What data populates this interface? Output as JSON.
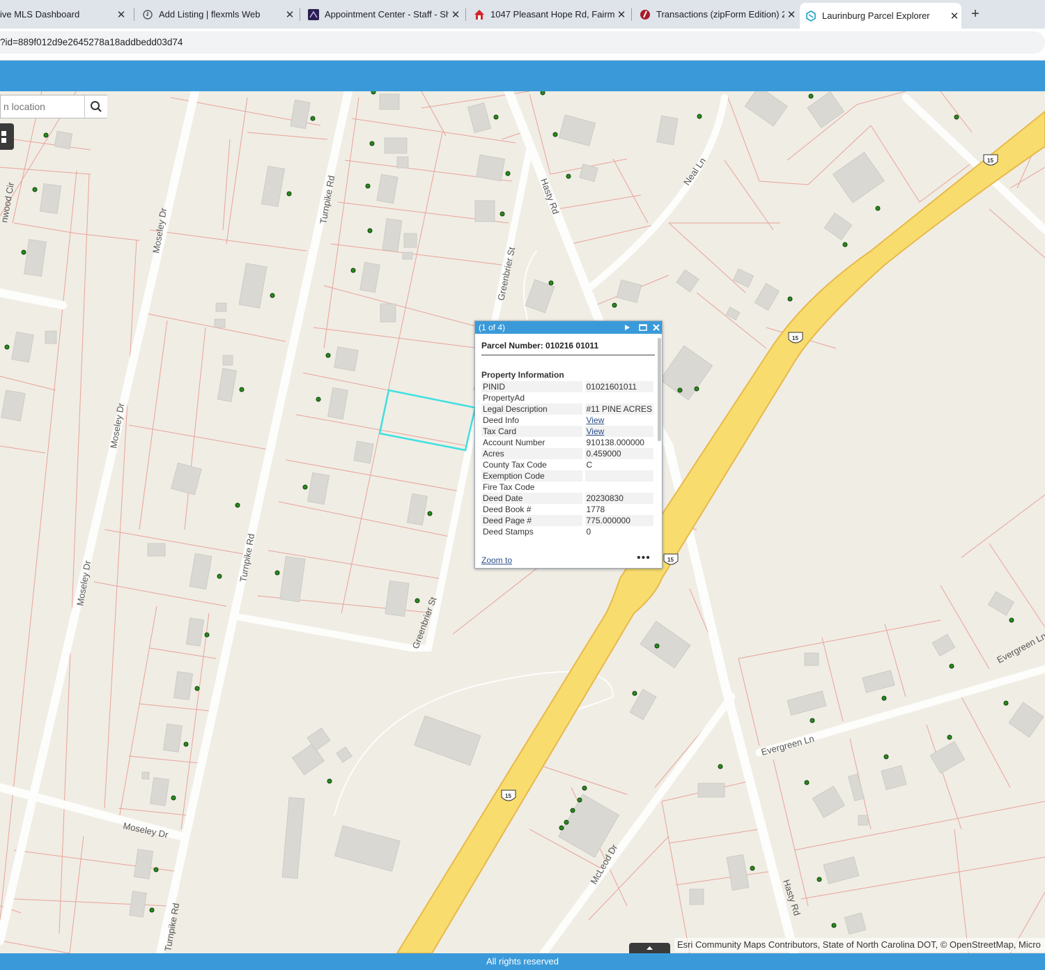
{
  "browser": {
    "tabs": [
      {
        "title": "ive MLS Dashboard",
        "icon": "blank-icon"
      },
      {
        "title": "Add Listing | flexmls Web",
        "icon": "flexmls-icon"
      },
      {
        "title": "Appointment Center - Staff - Sh",
        "icon": "showingtime-icon"
      },
      {
        "title": "1047 Pleasant Hope Rd, Fairmo",
        "icon": "house-icon"
      },
      {
        "title": "Transactions (zipForm Edition) 2",
        "icon": "zipform-icon"
      },
      {
        "title": "Laurinburg Parcel Explorer",
        "icon": "arcgis-icon",
        "active": true
      }
    ],
    "url": "?id=889f012d9e2645278a18addbedd03d74"
  },
  "search": {
    "placeholder": "n location"
  },
  "map": {
    "streets": [
      "Turnpike Rd",
      "Turnpike Rd",
      "Turnpike Rd",
      "Moseley Dr",
      "Moseley Dr",
      "Moseley Dr",
      "Moseley Dr",
      "Greenbrier St",
      "Greenbrier St",
      "Hasty Rd",
      "Hasty Rd",
      "Neal Ln",
      "Evergreen Ln",
      "Evergreen Ln",
      "McLeod Dr",
      "nwood Cir"
    ],
    "route_shields": [
      "15",
      "15",
      "15",
      "15"
    ]
  },
  "popup": {
    "counter": "(1 of 4)",
    "title": "Parcel Number: 010216 01011",
    "section": "Property Information",
    "rows": [
      {
        "k": "PINID",
        "v": "01021601011"
      },
      {
        "k": "PropertyAd",
        "v": ""
      },
      {
        "k": "Legal Description",
        "v": "#11 PINE ACRES"
      },
      {
        "k": "Deed Info",
        "v": "View",
        "link": true
      },
      {
        "k": "Tax Card",
        "v": "View",
        "link": true
      },
      {
        "k": "Account Number",
        "v": "910138.000000"
      },
      {
        "k": "Acres",
        "v": "0.459000"
      },
      {
        "k": "County Tax Code",
        "v": "C"
      },
      {
        "k": "Exemption Code",
        "v": ""
      },
      {
        "k": "Fire Tax Code",
        "v": ""
      },
      {
        "k": "Deed Date",
        "v": "20230830"
      },
      {
        "k": "Deed Book #",
        "v": "1778"
      },
      {
        "k": "Deed Page #",
        "v": "775.000000"
      },
      {
        "k": "Deed Stamps",
        "v": "0"
      }
    ],
    "zoom_label": "Zoom to",
    "more_label": "•••"
  },
  "attribution": "Esri Community Maps Contributors, State of North Carolina DOT, © OpenStreetMap, Micro",
  "footer": "All rights reserved",
  "colors": {
    "header": "#3a9ad9",
    "highway": "#f8dd6e",
    "parcel_line": "#e89a8e",
    "selection": "#3ee0e0"
  }
}
